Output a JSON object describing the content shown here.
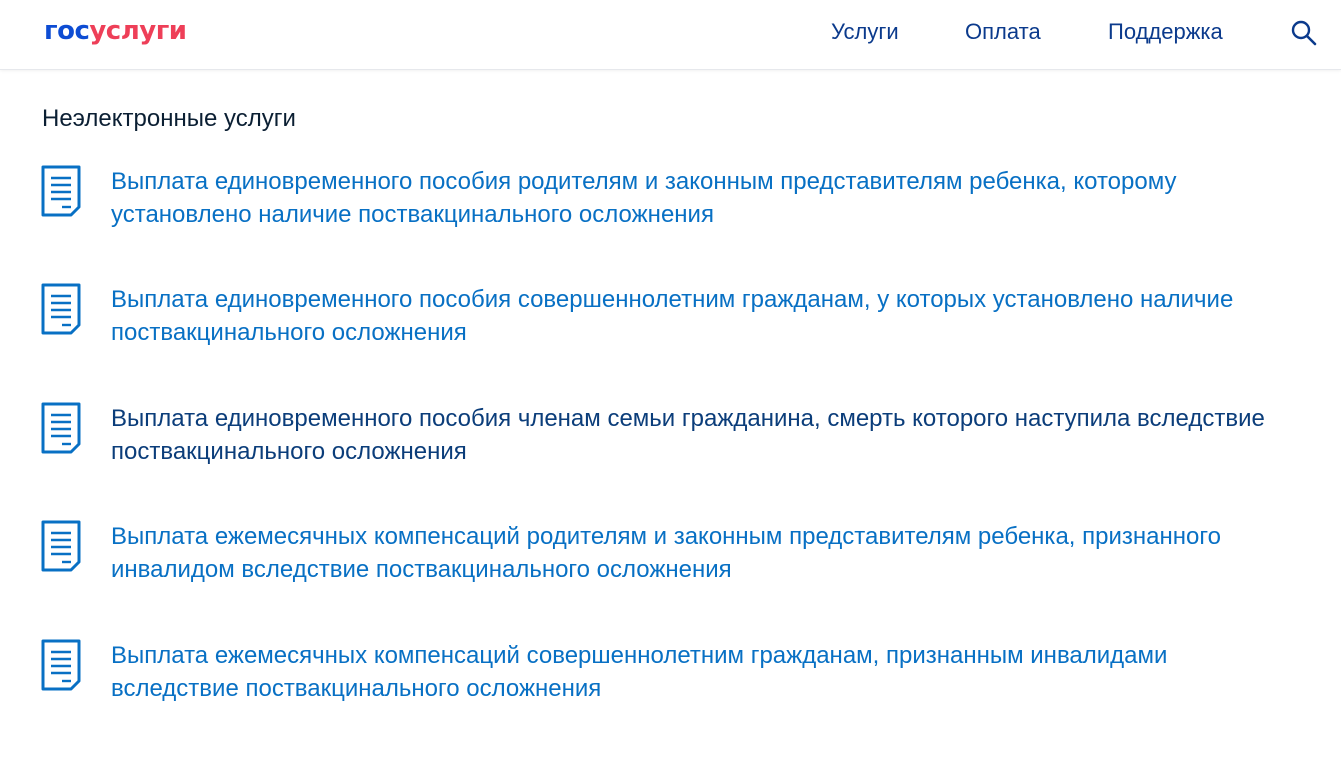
{
  "header": {
    "logo": {
      "part1": "гос",
      "part2": "услуги"
    },
    "nav": [
      {
        "label": "Услуги"
      },
      {
        "label": "Оплата"
      },
      {
        "label": "Поддержка"
      }
    ],
    "search_icon": "search-icon"
  },
  "section": {
    "title": "Неэлектронные услуги",
    "items": [
      {
        "icon": "document-icon",
        "label": "Выплата единовременного пособия родителям и законным представителям ребенка, которому установлено наличие поствакцинального осложнения"
      },
      {
        "icon": "document-icon",
        "label": "Выплата единовременного пособия совершеннолетним гражданам, у которых установлено наличие поствакцинального осложнения"
      },
      {
        "icon": "document-icon",
        "label": "Выплата единовременного пособия членам семьи гражданина, смерть которого наступила вследствие поствакцинального осложнения"
      },
      {
        "icon": "document-icon",
        "label": "Выплата ежемесячных компенсаций родителям и законным представителям ребенка, признанного инвалидом вследствие поствакцинального осложнения"
      },
      {
        "icon": "document-icon",
        "label": "Выплата ежемесячных компенсаций совершеннолетним гражданам, признанным инвалидами вследствие поствакцинального осложнения"
      }
    ]
  },
  "colors": {
    "brand_blue": "#0d4cd3",
    "brand_red": "#ee3f58",
    "link": "#0870c4",
    "nav": "#0b3a8c",
    "text": "#0b1f33"
  }
}
